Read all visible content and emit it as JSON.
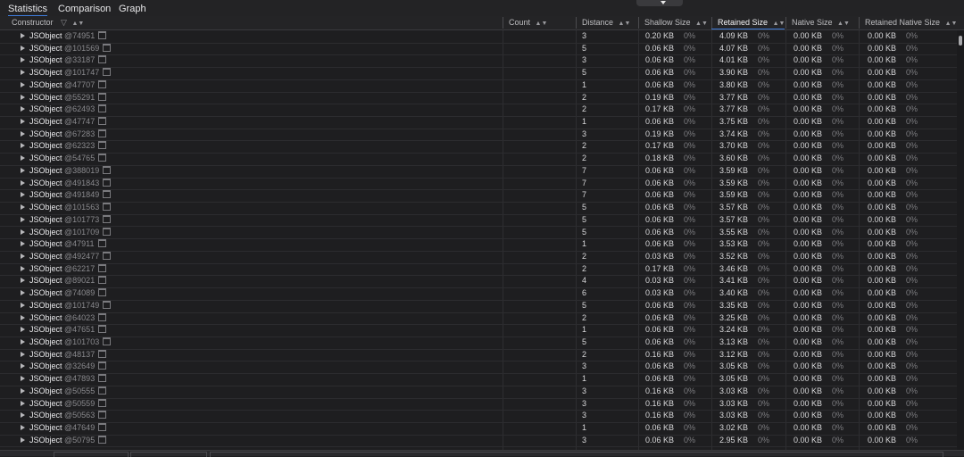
{
  "tabs": [
    {
      "label": "Statistics",
      "active": true
    },
    {
      "label": "Comparison",
      "active": false
    },
    {
      "label": "Graph",
      "active": false
    }
  ],
  "columns": {
    "constructor": "Constructor",
    "count": "Count",
    "distance": "Distance",
    "shallow": "Shallow Size",
    "retained": "Retained Size",
    "native": "Native Size",
    "retained_native": "Retained Native Size"
  },
  "sorted_column": "Retained Size",
  "icons": {
    "filter": "funnel-icon",
    "sort": "sort-arrows-icon",
    "expand": "disclosure-triangle-icon",
    "object": "document-icon"
  },
  "rows": [
    {
      "name": "JSObject",
      "id": "@74951",
      "distance": "3",
      "shallow": "0.20 KB",
      "shallow_pct": "0%",
      "retained": "4.09 KB",
      "retained_pct": "0%",
      "native": "0.00 KB",
      "native_pct": "0%",
      "rnative": "0.00 KB",
      "rnative_pct": "0%"
    },
    {
      "name": "JSObject",
      "id": "@101569",
      "distance": "5",
      "shallow": "0.06 KB",
      "shallow_pct": "0%",
      "retained": "4.07 KB",
      "retained_pct": "0%",
      "native": "0.00 KB",
      "native_pct": "0%",
      "rnative": "0.00 KB",
      "rnative_pct": "0%"
    },
    {
      "name": "JSObject",
      "id": "@33187",
      "distance": "3",
      "shallow": "0.06 KB",
      "shallow_pct": "0%",
      "retained": "4.01 KB",
      "retained_pct": "0%",
      "native": "0.00 KB",
      "native_pct": "0%",
      "rnative": "0.00 KB",
      "rnative_pct": "0%"
    },
    {
      "name": "JSObject",
      "id": "@101747",
      "distance": "5",
      "shallow": "0.06 KB",
      "shallow_pct": "0%",
      "retained": "3.90 KB",
      "retained_pct": "0%",
      "native": "0.00 KB",
      "native_pct": "0%",
      "rnative": "0.00 KB",
      "rnative_pct": "0%"
    },
    {
      "name": "JSObject",
      "id": "@47707",
      "distance": "1",
      "shallow": "0.06 KB",
      "shallow_pct": "0%",
      "retained": "3.80 KB",
      "retained_pct": "0%",
      "native": "0.00 KB",
      "native_pct": "0%",
      "rnative": "0.00 KB",
      "rnative_pct": "0%"
    },
    {
      "name": "JSObject",
      "id": "@55291",
      "distance": "2",
      "shallow": "0.19 KB",
      "shallow_pct": "0%",
      "retained": "3.77 KB",
      "retained_pct": "0%",
      "native": "0.00 KB",
      "native_pct": "0%",
      "rnative": "0.00 KB",
      "rnative_pct": "0%"
    },
    {
      "name": "JSObject",
      "id": "@62493",
      "distance": "2",
      "shallow": "0.17 KB",
      "shallow_pct": "0%",
      "retained": "3.77 KB",
      "retained_pct": "0%",
      "native": "0.00 KB",
      "native_pct": "0%",
      "rnative": "0.00 KB",
      "rnative_pct": "0%"
    },
    {
      "name": "JSObject",
      "id": "@47747",
      "distance": "1",
      "shallow": "0.06 KB",
      "shallow_pct": "0%",
      "retained": "3.75 KB",
      "retained_pct": "0%",
      "native": "0.00 KB",
      "native_pct": "0%",
      "rnative": "0.00 KB",
      "rnative_pct": "0%"
    },
    {
      "name": "JSObject",
      "id": "@67283",
      "distance": "3",
      "shallow": "0.19 KB",
      "shallow_pct": "0%",
      "retained": "3.74 KB",
      "retained_pct": "0%",
      "native": "0.00 KB",
      "native_pct": "0%",
      "rnative": "0.00 KB",
      "rnative_pct": "0%"
    },
    {
      "name": "JSObject",
      "id": "@62323",
      "distance": "2",
      "shallow": "0.17 KB",
      "shallow_pct": "0%",
      "retained": "3.70 KB",
      "retained_pct": "0%",
      "native": "0.00 KB",
      "native_pct": "0%",
      "rnative": "0.00 KB",
      "rnative_pct": "0%"
    },
    {
      "name": "JSObject",
      "id": "@54765",
      "distance": "2",
      "shallow": "0.18 KB",
      "shallow_pct": "0%",
      "retained": "3.60 KB",
      "retained_pct": "0%",
      "native": "0.00 KB",
      "native_pct": "0%",
      "rnative": "0.00 KB",
      "rnative_pct": "0%"
    },
    {
      "name": "JSObject",
      "id": "@388019",
      "distance": "7",
      "shallow": "0.06 KB",
      "shallow_pct": "0%",
      "retained": "3.59 KB",
      "retained_pct": "0%",
      "native": "0.00 KB",
      "native_pct": "0%",
      "rnative": "0.00 KB",
      "rnative_pct": "0%"
    },
    {
      "name": "JSObject",
      "id": "@491843",
      "distance": "7",
      "shallow": "0.06 KB",
      "shallow_pct": "0%",
      "retained": "3.59 KB",
      "retained_pct": "0%",
      "native": "0.00 KB",
      "native_pct": "0%",
      "rnative": "0.00 KB",
      "rnative_pct": "0%"
    },
    {
      "name": "JSObject",
      "id": "@491849",
      "distance": "7",
      "shallow": "0.06 KB",
      "shallow_pct": "0%",
      "retained": "3.59 KB",
      "retained_pct": "0%",
      "native": "0.00 KB",
      "native_pct": "0%",
      "rnative": "0.00 KB",
      "rnative_pct": "0%"
    },
    {
      "name": "JSObject",
      "id": "@101563",
      "distance": "5",
      "shallow": "0.06 KB",
      "shallow_pct": "0%",
      "retained": "3.57 KB",
      "retained_pct": "0%",
      "native": "0.00 KB",
      "native_pct": "0%",
      "rnative": "0.00 KB",
      "rnative_pct": "0%"
    },
    {
      "name": "JSObject",
      "id": "@101773",
      "distance": "5",
      "shallow": "0.06 KB",
      "shallow_pct": "0%",
      "retained": "3.57 KB",
      "retained_pct": "0%",
      "native": "0.00 KB",
      "native_pct": "0%",
      "rnative": "0.00 KB",
      "rnative_pct": "0%"
    },
    {
      "name": "JSObject",
      "id": "@101709",
      "distance": "5",
      "shallow": "0.06 KB",
      "shallow_pct": "0%",
      "retained": "3.55 KB",
      "retained_pct": "0%",
      "native": "0.00 KB",
      "native_pct": "0%",
      "rnative": "0.00 KB",
      "rnative_pct": "0%"
    },
    {
      "name": "JSObject",
      "id": "@47911",
      "distance": "1",
      "shallow": "0.06 KB",
      "shallow_pct": "0%",
      "retained": "3.53 KB",
      "retained_pct": "0%",
      "native": "0.00 KB",
      "native_pct": "0%",
      "rnative": "0.00 KB",
      "rnative_pct": "0%"
    },
    {
      "name": "JSObject",
      "id": "@492477",
      "distance": "2",
      "shallow": "0.03 KB",
      "shallow_pct": "0%",
      "retained": "3.52 KB",
      "retained_pct": "0%",
      "native": "0.00 KB",
      "native_pct": "0%",
      "rnative": "0.00 KB",
      "rnative_pct": "0%"
    },
    {
      "name": "JSObject",
      "id": "@62217",
      "distance": "2",
      "shallow": "0.17 KB",
      "shallow_pct": "0%",
      "retained": "3.46 KB",
      "retained_pct": "0%",
      "native": "0.00 KB",
      "native_pct": "0%",
      "rnative": "0.00 KB",
      "rnative_pct": "0%"
    },
    {
      "name": "JSObject",
      "id": "@89021",
      "distance": "4",
      "shallow": "0.03 KB",
      "shallow_pct": "0%",
      "retained": "3.41 KB",
      "retained_pct": "0%",
      "native": "0.00 KB",
      "native_pct": "0%",
      "rnative": "0.00 KB",
      "rnative_pct": "0%"
    },
    {
      "name": "JSObject",
      "id": "@74089",
      "distance": "6",
      "shallow": "0.03 KB",
      "shallow_pct": "0%",
      "retained": "3.40 KB",
      "retained_pct": "0%",
      "native": "0.00 KB",
      "native_pct": "0%",
      "rnative": "0.00 KB",
      "rnative_pct": "0%"
    },
    {
      "name": "JSObject",
      "id": "@101749",
      "distance": "5",
      "shallow": "0.06 KB",
      "shallow_pct": "0%",
      "retained": "3.35 KB",
      "retained_pct": "0%",
      "native": "0.00 KB",
      "native_pct": "0%",
      "rnative": "0.00 KB",
      "rnative_pct": "0%"
    },
    {
      "name": "JSObject",
      "id": "@64023",
      "distance": "2",
      "shallow": "0.06 KB",
      "shallow_pct": "0%",
      "retained": "3.25 KB",
      "retained_pct": "0%",
      "native": "0.00 KB",
      "native_pct": "0%",
      "rnative": "0.00 KB",
      "rnative_pct": "0%"
    },
    {
      "name": "JSObject",
      "id": "@47651",
      "distance": "1",
      "shallow": "0.06 KB",
      "shallow_pct": "0%",
      "retained": "3.24 KB",
      "retained_pct": "0%",
      "native": "0.00 KB",
      "native_pct": "0%",
      "rnative": "0.00 KB",
      "rnative_pct": "0%"
    },
    {
      "name": "JSObject",
      "id": "@101703",
      "distance": "5",
      "shallow": "0.06 KB",
      "shallow_pct": "0%",
      "retained": "3.13 KB",
      "retained_pct": "0%",
      "native": "0.00 KB",
      "native_pct": "0%",
      "rnative": "0.00 KB",
      "rnative_pct": "0%"
    },
    {
      "name": "JSObject",
      "id": "@48137",
      "distance": "2",
      "shallow": "0.16 KB",
      "shallow_pct": "0%",
      "retained": "3.12 KB",
      "retained_pct": "0%",
      "native": "0.00 KB",
      "native_pct": "0%",
      "rnative": "0.00 KB",
      "rnative_pct": "0%"
    },
    {
      "name": "JSObject",
      "id": "@32649",
      "distance": "3",
      "shallow": "0.06 KB",
      "shallow_pct": "0%",
      "retained": "3.05 KB",
      "retained_pct": "0%",
      "native": "0.00 KB",
      "native_pct": "0%",
      "rnative": "0.00 KB",
      "rnative_pct": "0%"
    },
    {
      "name": "JSObject",
      "id": "@47893",
      "distance": "1",
      "shallow": "0.06 KB",
      "shallow_pct": "0%",
      "retained": "3.05 KB",
      "retained_pct": "0%",
      "native": "0.00 KB",
      "native_pct": "0%",
      "rnative": "0.00 KB",
      "rnative_pct": "0%"
    },
    {
      "name": "JSObject",
      "id": "@50555",
      "distance": "3",
      "shallow": "0.16 KB",
      "shallow_pct": "0%",
      "retained": "3.03 KB",
      "retained_pct": "0%",
      "native": "0.00 KB",
      "native_pct": "0%",
      "rnative": "0.00 KB",
      "rnative_pct": "0%"
    },
    {
      "name": "JSObject",
      "id": "@50559",
      "distance": "3",
      "shallow": "0.16 KB",
      "shallow_pct": "0%",
      "retained": "3.03 KB",
      "retained_pct": "0%",
      "native": "0.00 KB",
      "native_pct": "0%",
      "rnative": "0.00 KB",
      "rnative_pct": "0%"
    },
    {
      "name": "JSObject",
      "id": "@50563",
      "distance": "3",
      "shallow": "0.16 KB",
      "shallow_pct": "0%",
      "retained": "3.03 KB",
      "retained_pct": "0%",
      "native": "0.00 KB",
      "native_pct": "0%",
      "rnative": "0.00 KB",
      "rnative_pct": "0%"
    },
    {
      "name": "JSObject",
      "id": "@47649",
      "distance": "1",
      "shallow": "0.06 KB",
      "shallow_pct": "0%",
      "retained": "3.02 KB",
      "retained_pct": "0%",
      "native": "0.00 KB",
      "native_pct": "0%",
      "rnative": "0.00 KB",
      "rnative_pct": "0%"
    },
    {
      "name": "JSObject",
      "id": "@50795",
      "distance": "3",
      "shallow": "0.06 KB",
      "shallow_pct": "0%",
      "retained": "2.95 KB",
      "retained_pct": "0%",
      "native": "0.00 KB",
      "native_pct": "0%",
      "rnative": "0.00 KB",
      "rnative_pct": "0%"
    }
  ]
}
